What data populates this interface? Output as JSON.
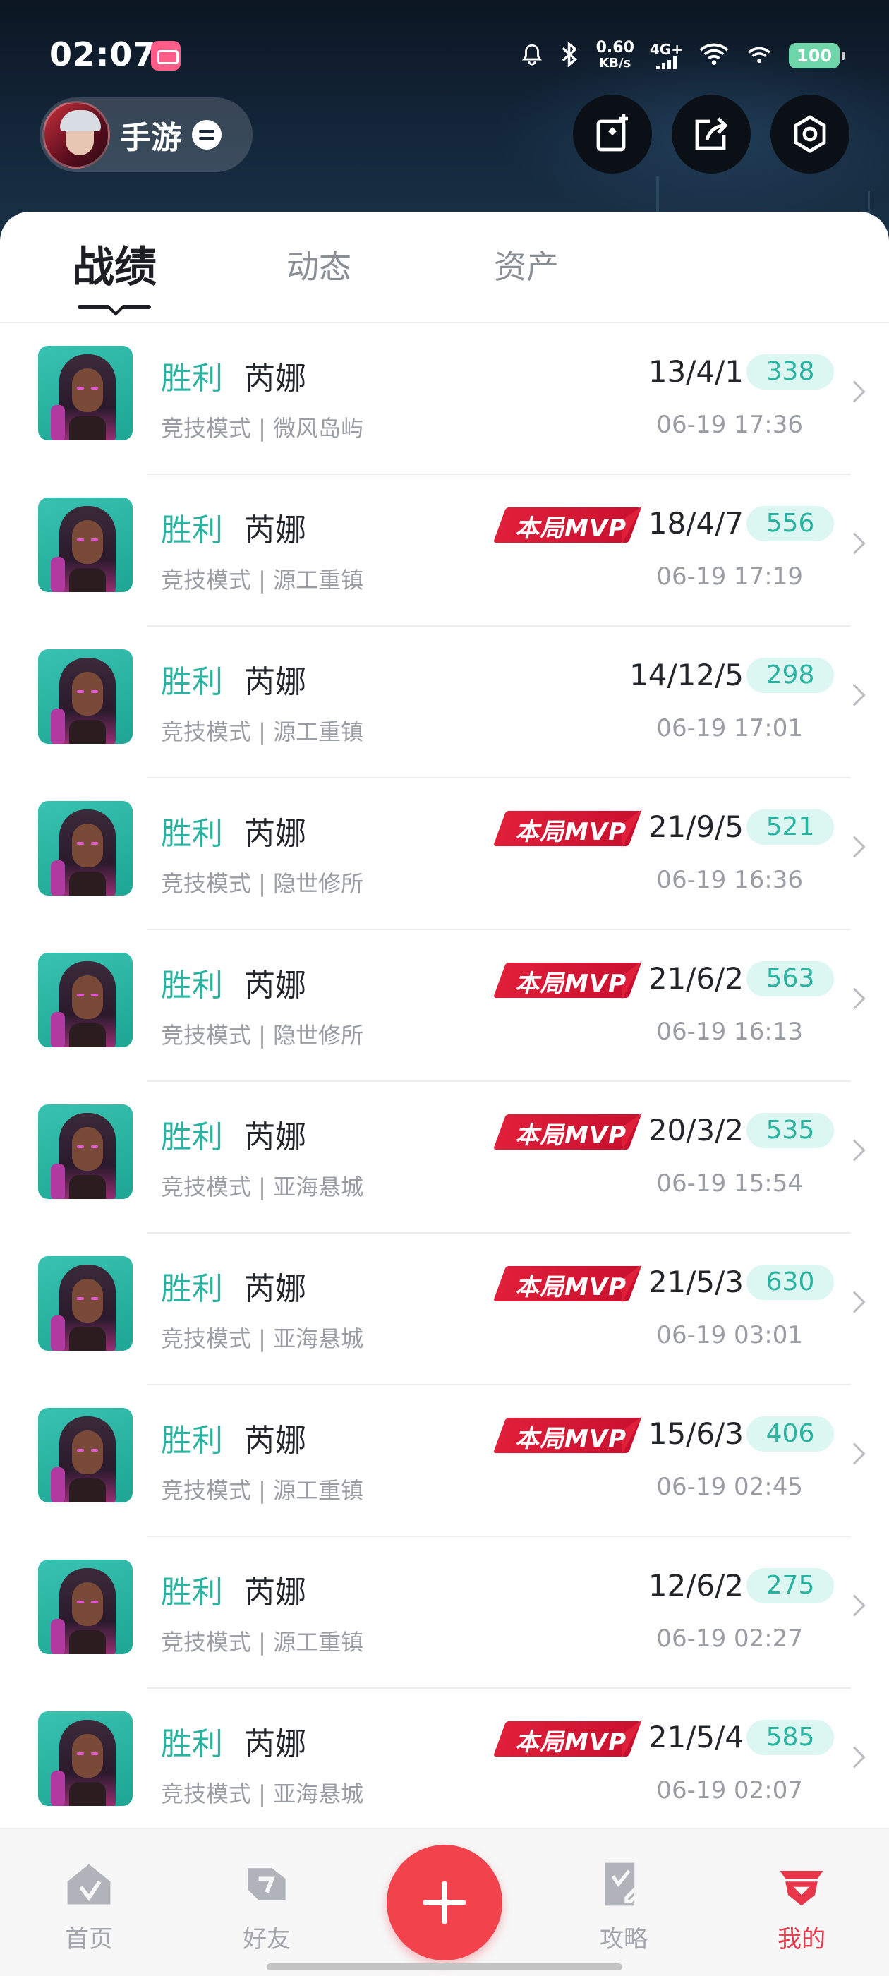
{
  "status_bar": {
    "time": "02:07",
    "net_speed_value": "0.60",
    "net_speed_unit": "KB/s",
    "network_type": "4G+",
    "battery": "100"
  },
  "header": {
    "game_name": "手游"
  },
  "tabs": [
    {
      "label": "战绩",
      "active": true
    },
    {
      "label": "动态",
      "active": false
    },
    {
      "label": "资产",
      "active": false
    }
  ],
  "mvp_label": "本局MVP",
  "matches": [
    {
      "result": "胜利",
      "hero": "芮娜",
      "mode": "竞技模式 | 微风岛屿",
      "kda": "13/4/1",
      "score": "338",
      "time": "06-19 17:36",
      "mvp": false
    },
    {
      "result": "胜利",
      "hero": "芮娜",
      "mode": "竞技模式 | 源工重镇",
      "kda": "18/4/7",
      "score": "556",
      "time": "06-19 17:19",
      "mvp": true
    },
    {
      "result": "胜利",
      "hero": "芮娜",
      "mode": "竞技模式 | 源工重镇",
      "kda": "14/12/5",
      "score": "298",
      "time": "06-19 17:01",
      "mvp": false
    },
    {
      "result": "胜利",
      "hero": "芮娜",
      "mode": "竞技模式 | 隐世修所",
      "kda": "21/9/5",
      "score": "521",
      "time": "06-19 16:36",
      "mvp": true
    },
    {
      "result": "胜利",
      "hero": "芮娜",
      "mode": "竞技模式 | 隐世修所",
      "kda": "21/6/2",
      "score": "563",
      "time": "06-19 16:13",
      "mvp": true
    },
    {
      "result": "胜利",
      "hero": "芮娜",
      "mode": "竞技模式 | 亚海悬城",
      "kda": "20/3/2",
      "score": "535",
      "time": "06-19 15:54",
      "mvp": true
    },
    {
      "result": "胜利",
      "hero": "芮娜",
      "mode": "竞技模式 | 亚海悬城",
      "kda": "21/5/3",
      "score": "630",
      "time": "06-19 03:01",
      "mvp": true
    },
    {
      "result": "胜利",
      "hero": "芮娜",
      "mode": "竞技模式 | 源工重镇",
      "kda": "15/6/3",
      "score": "406",
      "time": "06-19 02:45",
      "mvp": true
    },
    {
      "result": "胜利",
      "hero": "芮娜",
      "mode": "竞技模式 | 源工重镇",
      "kda": "12/6/2",
      "score": "275",
      "time": "06-19 02:27",
      "mvp": false
    },
    {
      "result": "胜利",
      "hero": "芮娜",
      "mode": "竞技模式 | 亚海悬城",
      "kda": "21/5/4",
      "score": "585",
      "time": "06-19 02:07",
      "mvp": true
    }
  ],
  "bottom_nav": [
    {
      "label": "首页",
      "icon": "home-icon",
      "active": false
    },
    {
      "label": "好友",
      "icon": "friends-icon",
      "active": false
    },
    {
      "label": "攻略",
      "icon": "guide-icon",
      "active": false
    },
    {
      "label": "我的",
      "icon": "profile-icon",
      "active": true
    }
  ],
  "colors": {
    "accent_teal": "#2bb3a2",
    "mvp_red": "#e01f3a",
    "active_nav_red": "#e8364a",
    "plus_button": "#f2434d"
  }
}
